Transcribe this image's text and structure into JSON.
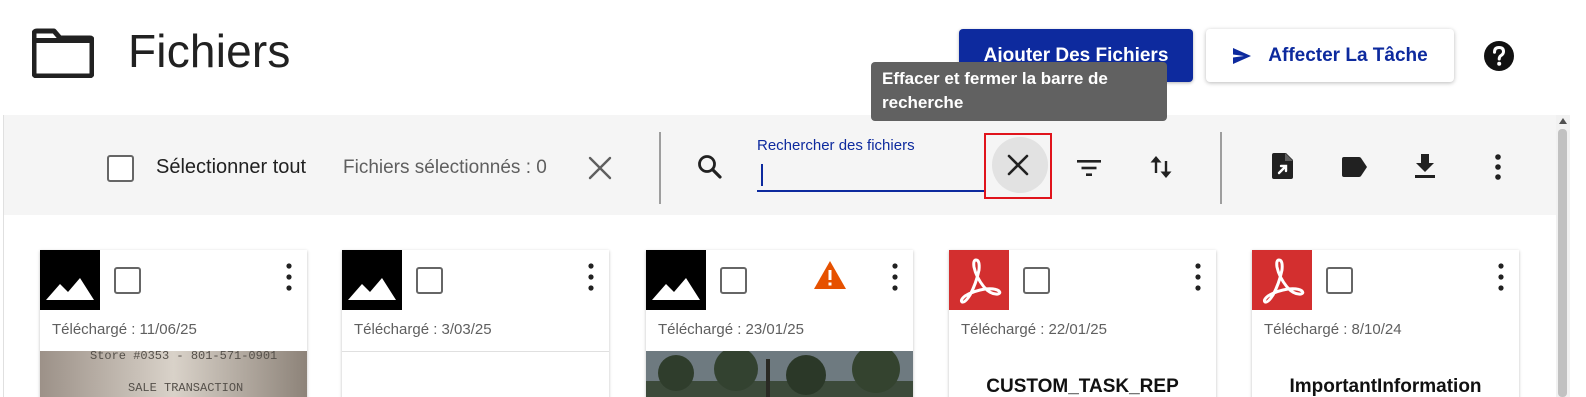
{
  "header": {
    "title": "Fichiers",
    "add_files_label": "Ajouter Des Fichiers",
    "assign_task_label": "Affecter La Tâche"
  },
  "tooltip": {
    "text": "Effacer et fermer la barre de recherche"
  },
  "toolbar": {
    "select_all_label": "Sélectionner tout",
    "selected_files_label": "Fichiers sélectionnés : 0",
    "search": {
      "label": "Rechercher des fichiers",
      "value": ""
    }
  },
  "cards": [
    {
      "type": "image",
      "uploaded": "Téléchargé : 11/06/25",
      "warning": false,
      "title": "",
      "preview": "receipt"
    },
    {
      "type": "image",
      "uploaded": "Téléchargé : 3/03/25",
      "warning": false,
      "title": "",
      "preview": "blank"
    },
    {
      "type": "image",
      "uploaded": "Téléchargé : 23/01/25",
      "warning": true,
      "title": "",
      "preview": "photo"
    },
    {
      "type": "pdf",
      "uploaded": "Téléchargé : 22/01/25",
      "warning": false,
      "title": "CUSTOM_TASK_REP",
      "preview": "document"
    },
    {
      "type": "pdf",
      "uploaded": "Téléchargé : 8/10/24",
      "warning": false,
      "title": "ImportantInformation",
      "preview": "document"
    }
  ],
  "receipt_preview_text": [
    "Store #0353 - 801-571-0901",
    "SALE TRANSACTION"
  ],
  "colors": {
    "primary": "#0d2a9e",
    "pdf_red": "#d32f2f",
    "warning": "#e65100",
    "toolbar_bg": "#f5f5f5",
    "highlight_border": "#e0141c"
  },
  "icons": {
    "header": [
      "folder-icon",
      "send-icon",
      "help-icon"
    ],
    "toolbar": [
      "close-icon",
      "search-icon",
      "close-icon",
      "filter-icon",
      "sort-icon",
      "export-file-icon",
      "label-icon",
      "download-icon",
      "more-vert-icon"
    ]
  }
}
